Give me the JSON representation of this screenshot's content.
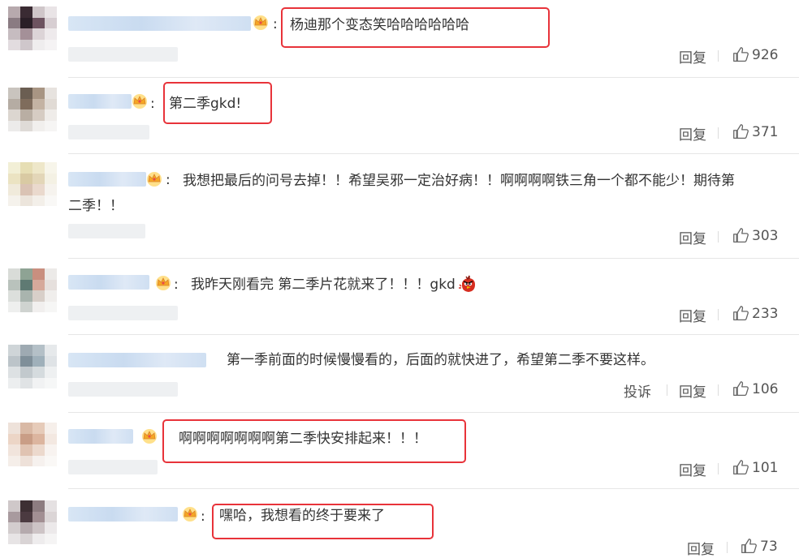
{
  "actions": {
    "reply": "回复",
    "report": "投诉"
  },
  "comments": [
    {
      "text": "杨迪那个变态笑哈哈哈哈哈哈",
      "likes": "926"
    },
    {
      "text": "第二季gkd!",
      "likes": "371"
    },
    {
      "text": "我想把最后的问号去掉！！希望吴邪一定治好病！！啊啊啊啊铁三角一个都不能少！期待第",
      "text2": "二季！！",
      "likes": "303"
    },
    {
      "text": "我昨天刚看完 第二季片花就来了！！！gkd",
      "likes": "233"
    },
    {
      "text": "第一季前面的时候慢慢看的，后面的就快进了，希望第二季不要这样。",
      "likes": "106"
    },
    {
      "text": "啊啊啊啊啊啊啊第二季快安排起来！！！",
      "likes": "101"
    },
    {
      "text": "嘿哈，我想看的终于要来了",
      "likes": "73"
    }
  ],
  "colors": {
    "highlight": "#e8333a",
    "text": "#333333",
    "action": "#555555"
  }
}
